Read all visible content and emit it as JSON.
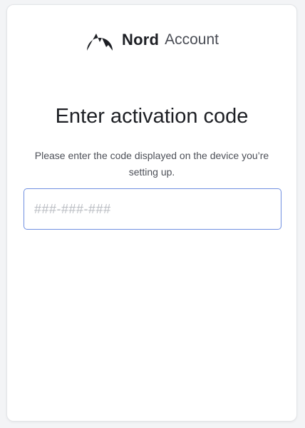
{
  "brand": {
    "name_bold": "Nord",
    "name_light": "Account"
  },
  "heading": "Enter activation code",
  "instructions": "Please enter the code displayed on the device you’re setting up.",
  "code_field": {
    "value": "",
    "placeholder": "###-###-###"
  },
  "colors": {
    "input_border": "#6f8fe0",
    "text_primary": "#1d1f24",
    "text_secondary": "#4d5058"
  }
}
